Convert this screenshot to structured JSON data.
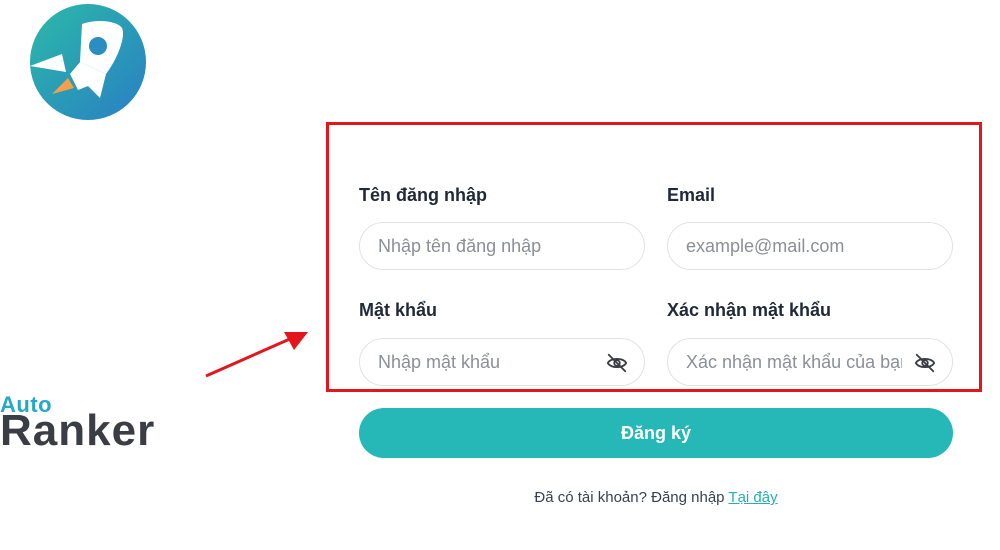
{
  "logo": {
    "line1": "Auto",
    "line2": "Ranker",
    "icon": "rocket-icon"
  },
  "form": {
    "username": {
      "label": "Tên đăng nhập",
      "placeholder": "Nhập tên đăng nhập",
      "value": ""
    },
    "email": {
      "label": "Email",
      "placeholder": "example@mail.com",
      "value": ""
    },
    "password": {
      "label": "Mật khẩu",
      "placeholder": "Nhập mật khẩu",
      "value": "",
      "toggle_icon": "eye-off-icon"
    },
    "confirm_password": {
      "label": "Xác nhận mật khẩu",
      "placeholder": "Xác nhận mật khẩu của bạn",
      "value": "",
      "toggle_icon": "eye-off-icon"
    },
    "submit_label": "Đăng ký"
  },
  "footer": {
    "text": "Đã có tài khoản? Đăng nhập ",
    "link": "Tại đây"
  },
  "colors": {
    "accent": "#26b7b7",
    "highlight": "#e3161c",
    "logo_blue": "#25a9c9",
    "logo_dark": "#3a3d44"
  }
}
